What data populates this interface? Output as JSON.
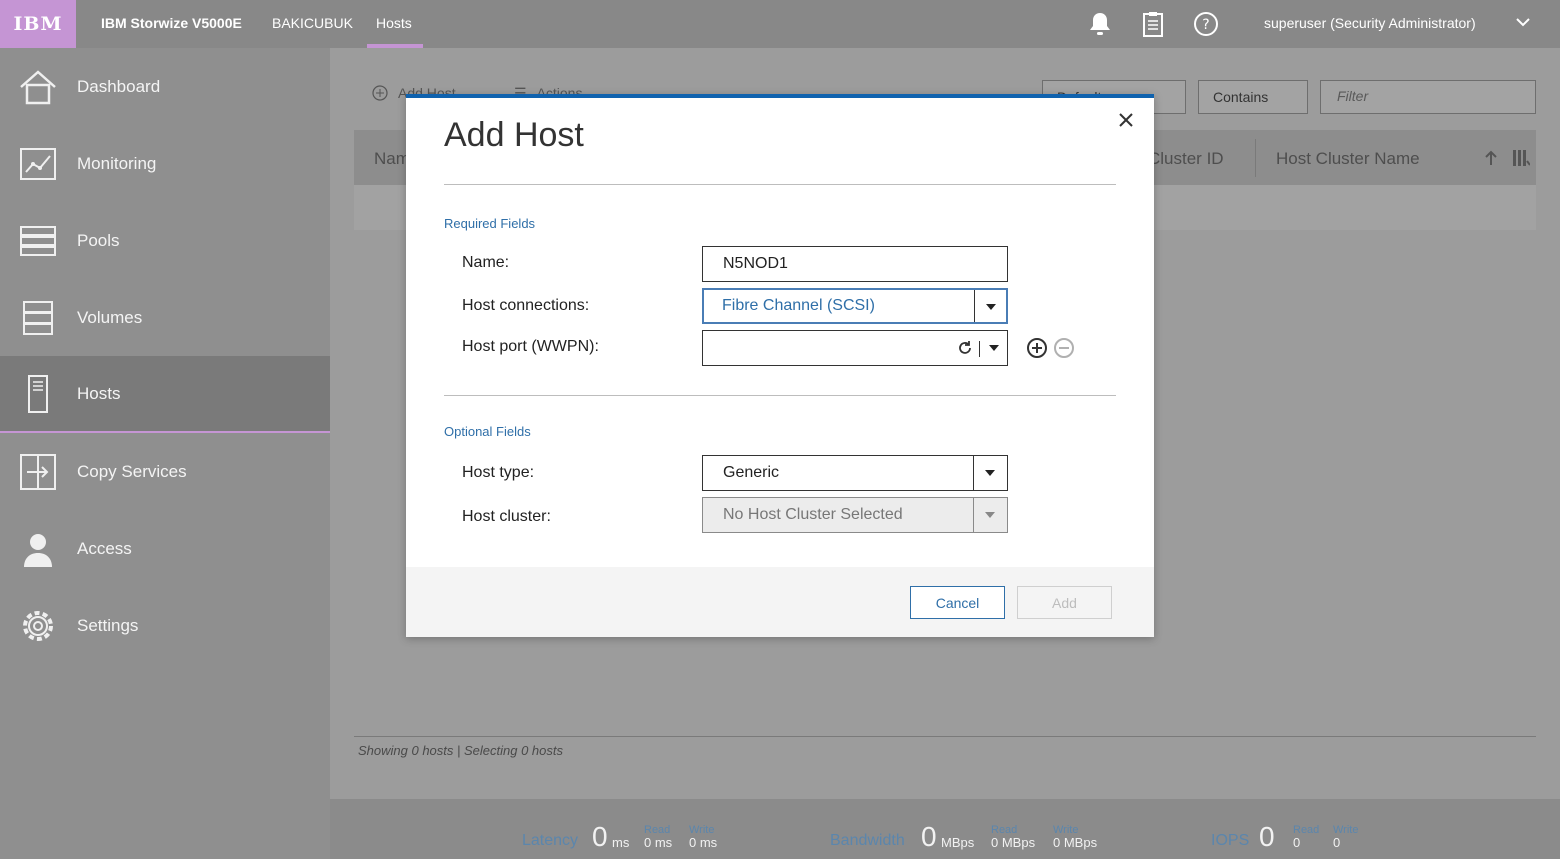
{
  "topbar": {
    "logo": "IBM",
    "product": "IBM Storwize V5000E",
    "system": "BAKICUBUK",
    "current_tab": "Hosts",
    "user": "superuser (Security Administrator)"
  },
  "sidebar": {
    "items": [
      {
        "label": "Dashboard",
        "icon": "home-icon"
      },
      {
        "label": "Monitoring",
        "icon": "monitoring-icon"
      },
      {
        "label": "Pools",
        "icon": "pools-icon"
      },
      {
        "label": "Volumes",
        "icon": "volumes-icon"
      },
      {
        "label": "Hosts",
        "icon": "host-icon"
      },
      {
        "label": "Copy Services",
        "icon": "copy-services-icon"
      },
      {
        "label": "Access",
        "icon": "access-icon"
      },
      {
        "label": "Settings",
        "icon": "gear-icon"
      }
    ]
  },
  "toolbar": {
    "add_host": "Add Host",
    "actions": "Actions",
    "default_select": "Default",
    "contains_select": "Contains",
    "filter_placeholder": "Filter"
  },
  "grid": {
    "col_name": "Nam",
    "col_cluster_id": "Cluster ID",
    "col_cluster_name": "Host Cluster Name"
  },
  "footer": {
    "status": "Showing 0 hosts | Selecting 0 hosts"
  },
  "stats": {
    "latency_label": "Latency",
    "latency_value": "0",
    "latency_unit": "ms",
    "latency_read": "0 ms",
    "latency_write": "0 ms",
    "bandwidth_label": "Bandwidth",
    "bandwidth_value": "0",
    "bandwidth_unit": "MBps",
    "bandwidth_read": "0 MBps",
    "bandwidth_write": "0 MBps",
    "iops_label": "IOPS",
    "iops_value": "0",
    "iops_read": "0",
    "iops_write": "0",
    "read_label": "Read",
    "write_label": "Write"
  },
  "modal": {
    "title": "Add Host",
    "required_section": "Required Fields",
    "optional_section": "Optional Fields",
    "name_label": "Name:",
    "name_value": "N5NOD1",
    "host_connections_label": "Host connections:",
    "host_connections_value": "Fibre Channel (SCSI)",
    "host_port_label": "Host port (WWPN):",
    "host_port_value": "",
    "host_type_label": "Host type:",
    "host_type_value": "Generic",
    "host_cluster_label": "Host cluster:",
    "host_cluster_value": "No Host Cluster Selected",
    "cancel_label": "Cancel",
    "add_label": "Add"
  },
  "colors": {
    "accent": "#c595d4",
    "link_blue": "#2f6fa8",
    "modal_top": "#0f62ae"
  }
}
